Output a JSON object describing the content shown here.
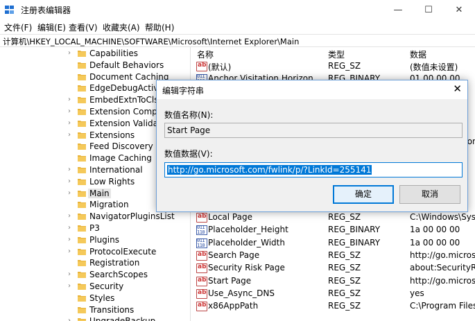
{
  "window": {
    "title": "注册表编辑器",
    "minimize": "—",
    "maximize": "☐",
    "close": "✕"
  },
  "menu": [
    "文件(F)",
    "编辑(E)",
    "查看(V)",
    "收藏夹(A)",
    "帮助(H)"
  ],
  "address": "计算机\\HKEY_LOCAL_MACHINE\\SOFTWARE\\Microsoft\\Internet Explorer\\Main",
  "tree": [
    {
      "label": "Capabilities",
      "has_children": true
    },
    {
      "label": "Default Behaviors",
      "has_children": false
    },
    {
      "label": "Document Caching",
      "has_children": false
    },
    {
      "label": "EdgeDebugActiv",
      "has_children": false
    },
    {
      "label": "EmbedExtnToClsi",
      "has_children": true
    },
    {
      "label": "Extension Compa",
      "has_children": true
    },
    {
      "label": "Extension Validat",
      "has_children": true
    },
    {
      "label": "Extensions",
      "has_children": true
    },
    {
      "label": "Feed Discovery",
      "has_children": false
    },
    {
      "label": "Image Caching",
      "has_children": false
    },
    {
      "label": "International",
      "has_children": true
    },
    {
      "label": "Low Rights",
      "has_children": true
    },
    {
      "label": "Main",
      "has_children": true,
      "selected": true
    },
    {
      "label": "Migration",
      "has_children": false
    },
    {
      "label": "NavigatorPluginsList",
      "has_children": true
    },
    {
      "label": "P3",
      "has_children": true
    },
    {
      "label": "Plugins",
      "has_children": true
    },
    {
      "label": "ProtocolExecute",
      "has_children": true
    },
    {
      "label": "Registration",
      "has_children": false
    },
    {
      "label": "SearchScopes",
      "has_children": true
    },
    {
      "label": "Security",
      "has_children": true
    },
    {
      "label": "Styles",
      "has_children": false
    },
    {
      "label": "Transitions",
      "has_children": false
    },
    {
      "label": "UpgradeBackup",
      "has_children": true
    }
  ],
  "list": {
    "headers": {
      "name": "名称",
      "type": "类型",
      "data": "数据"
    },
    "rows_top": [
      {
        "icon": "string-value-icon",
        "name": "(默认)",
        "type": "REG_SZ",
        "data": "(数值未设置)"
      },
      {
        "icon": "binary-value-icon",
        "name": "Anchor Visitation Horizon",
        "type": "REG_BINARY",
        "data": "01 00 00 00"
      }
    ],
    "partial_data": [
      "",
      "",
      "",
      "",
      "ton"
    ],
    "rows_bottom": [
      {
        "icon": "string-value-icon",
        "name": "Local Page",
        "type": "REG_SZ",
        "data": "C:\\Windows\\Syst"
      },
      {
        "icon": "binary-value-icon",
        "name": "Placeholder_Height",
        "type": "REG_BINARY",
        "data": "1a 00 00 00"
      },
      {
        "icon": "binary-value-icon",
        "name": "Placeholder_Width",
        "type": "REG_BINARY",
        "data": "1a 00 00 00"
      },
      {
        "icon": "string-value-icon",
        "name": "Search Page",
        "type": "REG_SZ",
        "data": "http://go.microso"
      },
      {
        "icon": "string-value-icon",
        "name": "Security Risk Page",
        "type": "REG_SZ",
        "data": "about:SecurityRis"
      },
      {
        "icon": "string-value-icon",
        "name": "Start Page",
        "type": "REG_SZ",
        "data": "http://go.microso"
      },
      {
        "icon": "string-value-icon",
        "name": "Use_Async_DNS",
        "type": "REG_SZ",
        "data": "yes"
      },
      {
        "icon": "string-value-icon",
        "name": "x86AppPath",
        "type": "REG_SZ",
        "data": "C:\\Program Files"
      }
    ]
  },
  "dialog": {
    "title": "编辑字符串",
    "close": "✕",
    "name_label": "数值名称(N):",
    "name_value": "Start Page",
    "data_label": "数值数据(V):",
    "data_value": "http://go.microsoft.com/fwlink/p/?LinkId=255141",
    "ok_label": "确定",
    "cancel_label": "取消"
  },
  "colors": {
    "accent": "#0078d7",
    "folder": "#e8b339",
    "string_icon": "#c33333",
    "binary_icon": "#2448a0"
  }
}
